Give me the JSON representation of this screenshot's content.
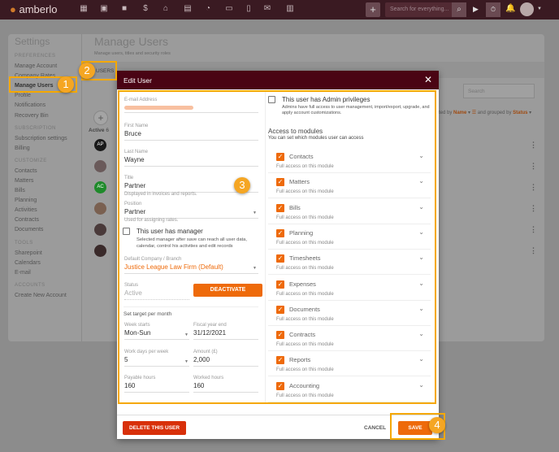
{
  "topbar": {
    "logo": "amberlo",
    "search_placeholder": "Search for everything...",
    "icons": [
      "dashboard-icon",
      "contacts-icon",
      "matters-icon",
      "bills-icon",
      "bank-icon",
      "calendar-icon",
      "timesheet-icon",
      "folder-icon",
      "documents-icon",
      "mail-icon",
      "reports-icon"
    ]
  },
  "settings": {
    "title": "Settings",
    "sections": [
      {
        "header": "PREFERENCES",
        "items": [
          "Manage Account",
          "Company Rates",
          "Manage Users",
          "Profile",
          "Notifications",
          "Recovery Bin"
        ]
      },
      {
        "header": "SUBSCRIPTION",
        "items": [
          "Subscription settings",
          "Billing"
        ]
      },
      {
        "header": "CUSTOMIZE",
        "items": [
          "Contacts",
          "Matters",
          "Bills",
          "Planning",
          "Activities",
          "Contracts",
          "Documents"
        ]
      },
      {
        "header": "TOOLS",
        "items": [
          "Sharepoint",
          "Calendars",
          "E-mail"
        ]
      },
      {
        "header": "ACCOUNTS",
        "items": [
          "Create New Account"
        ]
      }
    ]
  },
  "page": {
    "title": "Manage Users",
    "subtitle": "Manage users, titles and security roles",
    "tab_users": "USERS",
    "search_placeholder": "Search",
    "sorted_by": "rted by",
    "sort_field": "Name",
    "grouped_by": "and grouped by",
    "group_field": "Status",
    "group_active": "Active",
    "group_count": "6",
    "avatars": [
      {
        "initials": "AP",
        "color": "#1a1a1a"
      },
      {
        "initials": "",
        "color": "#6a5a5a"
      },
      {
        "initials": "AC",
        "color": "#1f8a2a"
      },
      {
        "initials": "",
        "color": "#7a6050"
      },
      {
        "initials": "",
        "color": "#4a3a3a"
      },
      {
        "initials": "",
        "color": "#3a2a2a"
      }
    ]
  },
  "modal": {
    "title": "Edit User",
    "email_label": "E-mail Address",
    "email_value": "",
    "first_name_label": "First Name",
    "first_name": "Bruce",
    "last_name_label": "Last Name",
    "last_name": "Wayne",
    "title_label": "Title",
    "title_value": "Partner",
    "title_hint": "Displayed in invoices and reports.",
    "position_label": "Position",
    "position_value": "Partner",
    "position_hint": "Used for assigning rates.",
    "manager_label": "This user has manager",
    "manager_desc": "Selected manager after save can reach all user data, calendar, control his activities and edit records",
    "company_label": "Default Company / Branch",
    "company_value": "Justice League Law Firm (Default)",
    "status_label": "Status",
    "status_value": "Active",
    "deactivate": "DEACTIVATE",
    "target_heading": "Set target per month",
    "week_starts_label": "Week starts",
    "week_starts": "Mon-Sun",
    "fiscal_label": "Fiscal year end",
    "fiscal": "31/12/2021",
    "work_days_label": "Work days per week",
    "work_days": "5",
    "amount_label": "Amount (£)",
    "amount": "2,000",
    "payable_label": "Payable hours",
    "payable": "160",
    "worked_label": "Worked hours",
    "worked": "160",
    "admin_label": "This user has Admin privileges",
    "admin_desc": "Admins have full access to user management, import/export, upgrade, and apply account customizations.",
    "modules_heading": "Access to modules",
    "modules_sub": "You can set which modules user can access",
    "modules": [
      {
        "name": "Contacts",
        "access": "Full access on this module"
      },
      {
        "name": "Matters",
        "access": "Full access on this module"
      },
      {
        "name": "Bills",
        "access": "Full access on this module"
      },
      {
        "name": "Planning",
        "access": "Full access on this module"
      },
      {
        "name": "Timesheets",
        "access": "Full access on this module"
      },
      {
        "name": "Expenses",
        "access": "Full access on this module"
      },
      {
        "name": "Documents",
        "access": "Full access on this module"
      },
      {
        "name": "Contracts",
        "access": "Full access on this module"
      },
      {
        "name": "Reports",
        "access": "Full access on this module"
      },
      {
        "name": "Accounting",
        "access": "Full access on this module"
      }
    ],
    "delete": "DELETE THIS USER",
    "cancel": "CANCEL",
    "save": "SAVE"
  },
  "badges": [
    "1",
    "2",
    "3",
    "4"
  ],
  "colors": {
    "accent": "#ee6a0a",
    "highlight": "#f5a800",
    "header": "#4a0414",
    "topbar": "#3a1a22",
    "danger": "#d8300a"
  }
}
